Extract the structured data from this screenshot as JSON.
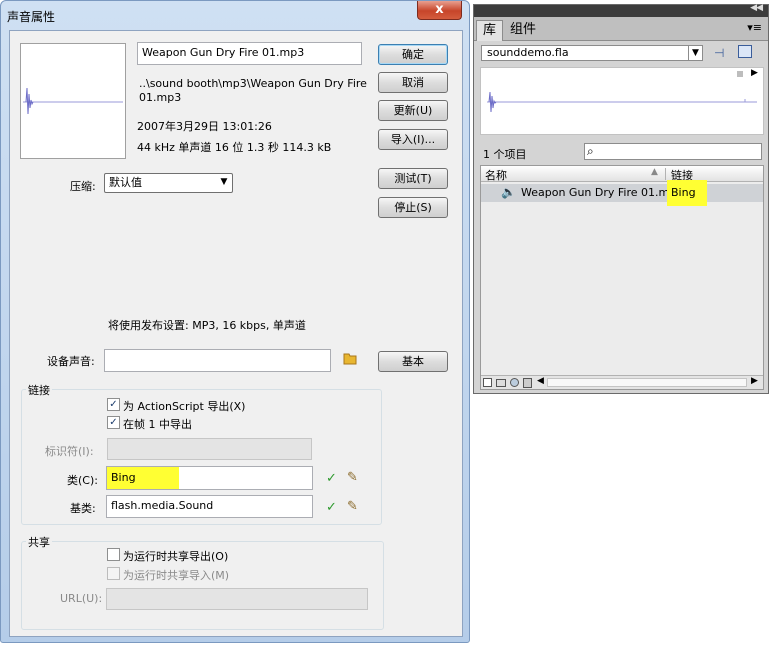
{
  "dialog": {
    "title": "声音属性",
    "close_label": "x",
    "file_name": "Weapon Gun Dry Fire 01.mp3",
    "path_line1": "..\\sound booth\\mp3\\Weapon Gun Dry Fire",
    "path_line2": "01.mp3",
    "date": "2007年3月29日  13:01:26",
    "info": "44 kHz 单声道 16 位 1.3 秒 114.3 kB",
    "buttons": {
      "ok": "确定",
      "cancel": "取消",
      "update": "更新(U)",
      "import": "导入(I)...",
      "test": "测试(T)",
      "stop": "停止(S)",
      "basic": "基本"
    },
    "compression_label": "压缩:",
    "compression_value": "默认值",
    "publish_note": "将使用发布设置: MP3, 16 kbps, 单声道",
    "device_sound_label": "设备声音:",
    "device_sound_value": "",
    "linkage": {
      "title": "链接",
      "export_actionscript": "为 ActionScript 导出(X)",
      "export_frame1": "在帧 1 中导出",
      "identifier_label": "标识符(I):",
      "identifier_value": "",
      "class_label": "类(C):",
      "class_value": "Bing",
      "base_class_label": "基类:",
      "base_class_value": "flash.media.Sound"
    },
    "sharing": {
      "title": "共享",
      "export_runtime": "为运行时共享导出(O)",
      "import_runtime": "为运行时共享导入(M)",
      "url_label": "URL(U):",
      "url_value": ""
    }
  },
  "library": {
    "tabs": [
      "库",
      "组件"
    ],
    "document": "sounddemo.fla",
    "item_count": "1 个项目",
    "columns": {
      "name": "名称",
      "linkage": "链接"
    },
    "items": [
      {
        "name": "Weapon Gun Dry Fire 01.mp3",
        "linkage": "Bing"
      }
    ]
  },
  "colors": {
    "waveform": "#7777cc",
    "highlight": "#ffff33",
    "checkmark": "#2e9a2e"
  }
}
